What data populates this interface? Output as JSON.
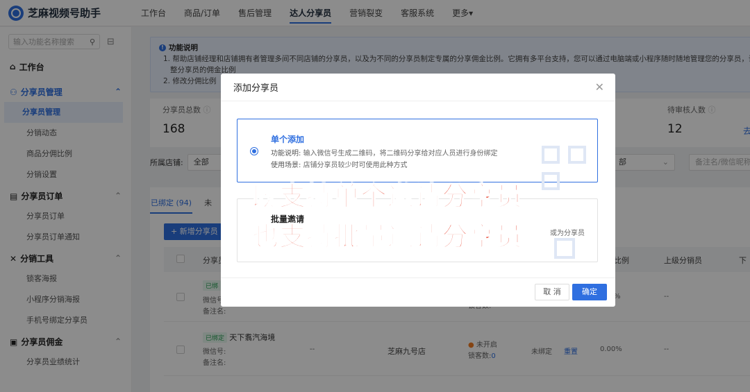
{
  "app": {
    "title": "芝麻视频号助手"
  },
  "nav": [
    "工作台",
    "商品/订单",
    "售后管理",
    "达人分享员",
    "营销裂变",
    "客服系统",
    "更多"
  ],
  "sidebar": {
    "search_placeholder": "输入功能名称搜索",
    "workbench": "工作台",
    "groups": [
      {
        "label": "分享员管理",
        "items": [
          "分享员管理",
          "分销动态",
          "商品分佣比例",
          "分销设置"
        ]
      },
      {
        "label": "分享员订单",
        "items": [
          "分享员订单",
          "分享员订单通知"
        ]
      },
      {
        "label": "分销工具",
        "items": [
          "锁客海报",
          "小程序分销海报",
          "手机号绑定分享员"
        ]
      },
      {
        "label": "分享员佣金",
        "items": [
          "分享员业绩统计"
        ]
      }
    ]
  },
  "info": {
    "title": "功能说明",
    "line1": "1. 帮助店铺经理和店铺拥有者管理多间不同店铺的分享员，以及为不同的分享员制定专属的分享佣金比例。它拥有多平台支持，您可以通过电脑端或小程序随时随地管理您的分享员，调",
    "line2": "整分享员的佣金比例",
    "line3": "2. 修改分佣比例"
  },
  "stats": {
    "total_label": "分享员总数",
    "total_value": "168",
    "pending_label": "待审核人数",
    "pending_value": "12",
    "pending_link": "去"
  },
  "filters": {
    "store_label": "所属店铺:",
    "store_value": "全部",
    "status_value": "部",
    "search_placeholder": "备注名/微信昵称"
  },
  "table": {
    "tab_bound": "已绑定 (94)",
    "tab_unbound": "未",
    "add_button": "+ 新增分享员",
    "headers": {
      "name": "分享员",
      "ratio": "比例",
      "upper": "上级分销员",
      "next": "下"
    },
    "rows": [
      {
        "badge": "已绑",
        "wx_label": "微信号:",
        "note_label": "备注名:",
        "lock_count": "锁客数:",
        "ratio": "%",
        "upper": "--"
      },
      {
        "badge": "已绑定",
        "name": "天下翥汽海境",
        "wx_label": "微信号:",
        "note_label": "备注名:",
        "dash": "--",
        "store": "芝麻九号店",
        "status": "未开启",
        "lock_label": "锁客数:",
        "lock_value": "0",
        "bind": "未绑定",
        "reset": "重置",
        "ratio": "0.00%",
        "upper": "--"
      }
    ]
  },
  "modal": {
    "title": "添加分享员",
    "single": {
      "title": "单个添加",
      "desc_label": "功能说明:",
      "desc": "输入微信号生成二维码，将二维码分享给对应人员进行身份绑定",
      "scene_label": "使用场景:",
      "scene": "店铺分享员较少时可使用此种方式"
    },
    "batch": {
      "title": "批量邀请",
      "tail": "或为分享员"
    },
    "cancel": "取 消",
    "ok": "确定"
  },
  "promo": {
    "line1": "既支持单个邀请分享员",
    "line2": "也支持批量邀请分享员"
  }
}
